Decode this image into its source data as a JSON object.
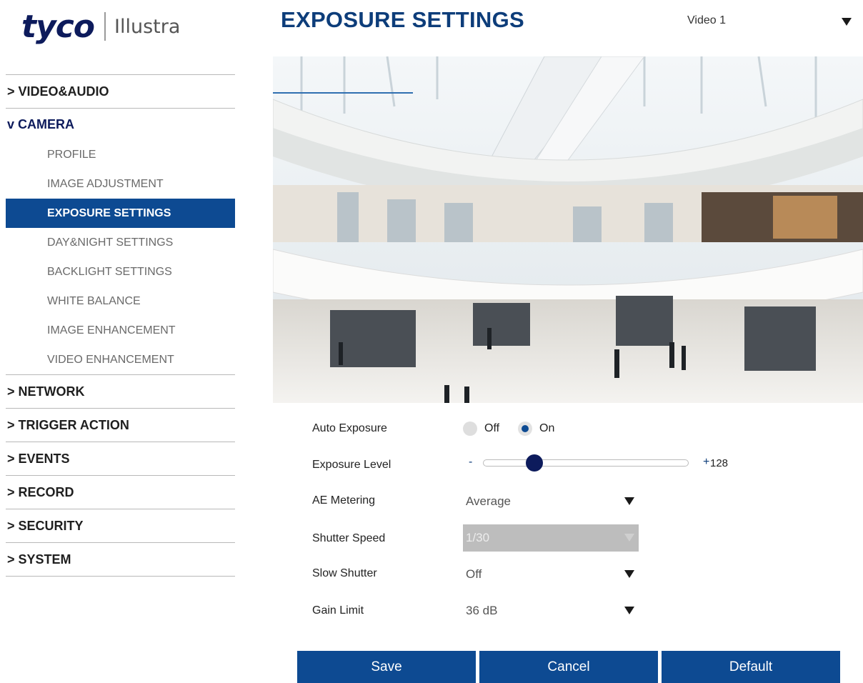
{
  "logo": {
    "brand": "tyco",
    "product": "Illustra"
  },
  "header": {
    "title": "EXPOSURE SETTINGS"
  },
  "video_select": {
    "value": "Video 1"
  },
  "sidebar": {
    "sections": [
      {
        "label": "> VIDEO&AUDIO"
      },
      {
        "label": "v CAMERA",
        "expanded": true
      },
      {
        "label": "> NETWORK"
      },
      {
        "label": "> TRIGGER ACTION"
      },
      {
        "label": "> EVENTS"
      },
      {
        "label": "> RECORD"
      },
      {
        "label": "> SECURITY"
      },
      {
        "label": "> SYSTEM"
      }
    ],
    "camera_items": [
      {
        "label": "PROFILE"
      },
      {
        "label": "IMAGE ADJUSTMENT"
      },
      {
        "label": "EXPOSURE SETTINGS",
        "active": true
      },
      {
        "label": "DAY&NIGHT SETTINGS"
      },
      {
        "label": "BACKLIGHT SETTINGS"
      },
      {
        "label": "WHITE BALANCE"
      },
      {
        "label": "IMAGE ENHANCEMENT"
      },
      {
        "label": "VIDEO ENHANCEMENT"
      }
    ]
  },
  "form": {
    "auto_exposure": {
      "label": "Auto Exposure",
      "off_label": "Off",
      "on_label": "On",
      "selected": "On"
    },
    "exposure_level": {
      "label": "Exposure Level",
      "minus": "-",
      "plus": "+",
      "value": "128",
      "fraction": 0.25
    },
    "ae_metering": {
      "label": "AE Metering",
      "value": "Average"
    },
    "shutter_speed": {
      "label": "Shutter Speed",
      "value": "1/30",
      "disabled": true
    },
    "slow_shutter": {
      "label": "Slow Shutter",
      "value": "Off"
    },
    "gain_limit": {
      "label": "Gain Limit",
      "value": "36 dB"
    }
  },
  "buttons": {
    "save": "Save",
    "cancel": "Cancel",
    "default": "Default"
  },
  "colors": {
    "accent": "#0d4a92",
    "brand_dark": "#0d1b5c",
    "title": "#0d3d7a"
  }
}
